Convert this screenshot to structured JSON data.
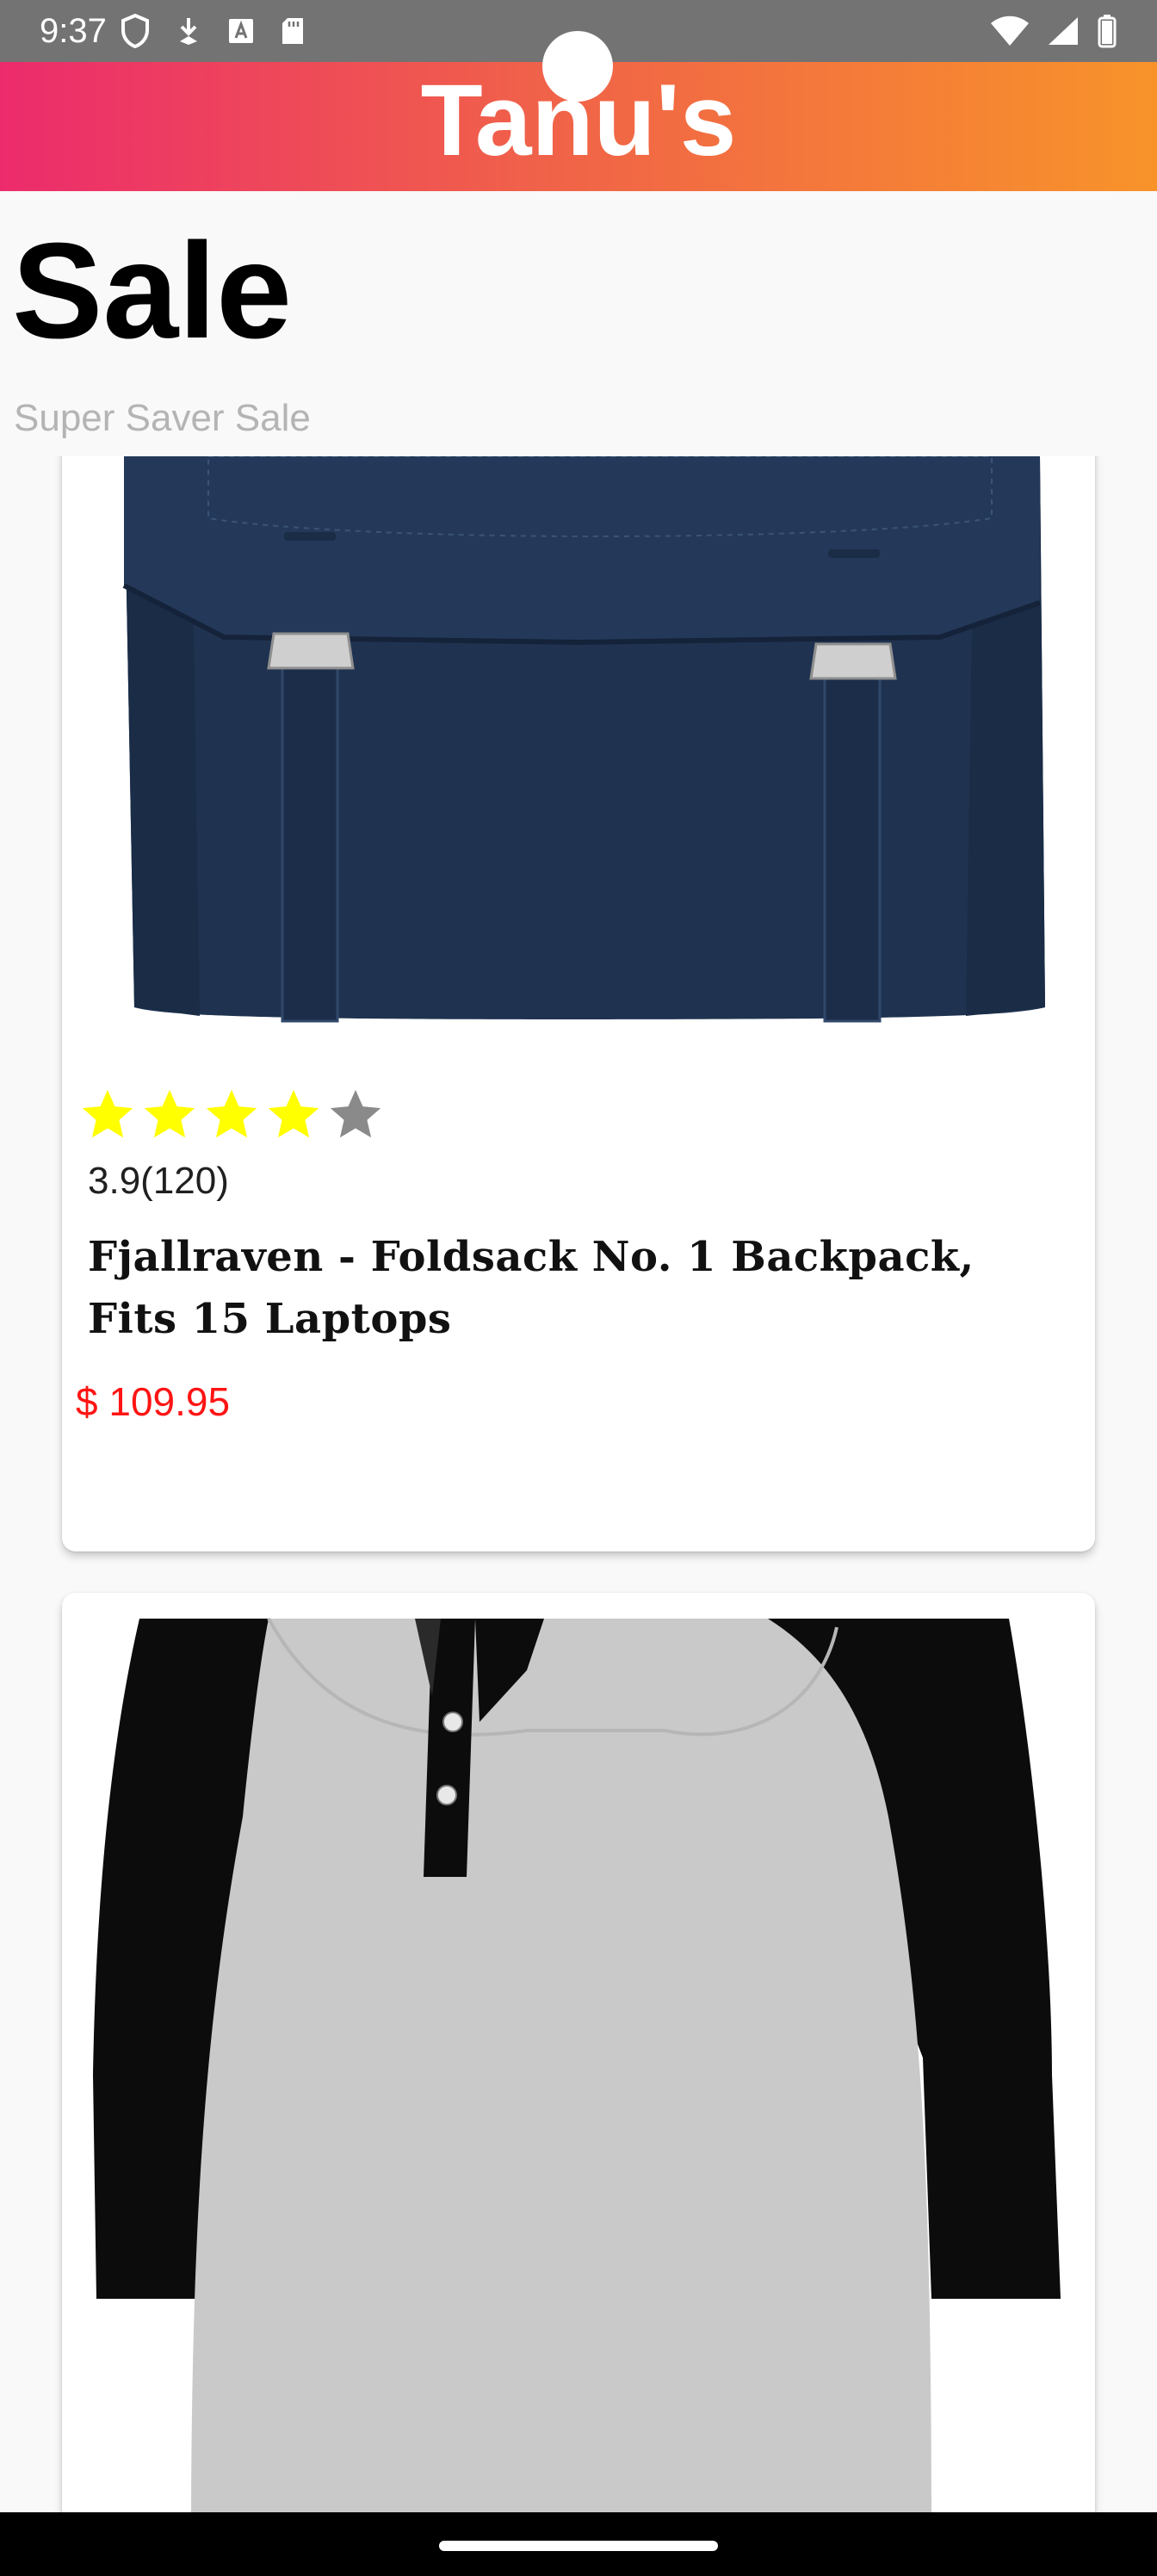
{
  "status_bar": {
    "time": "9:37",
    "left_icons": [
      "shield-icon",
      "download-icon",
      "font-icon",
      "sd-card-icon"
    ],
    "right_icons": [
      "wifi-icon",
      "signal-icon",
      "battery-icon"
    ]
  },
  "app_bar": {
    "title": "Tanu's",
    "gradient": [
      "#ec2b6c",
      "#f8932a"
    ]
  },
  "header": {
    "title": "Sale",
    "subtitle": "Super Saver Sale"
  },
  "products": [
    {
      "image": "backpack-image",
      "rating_stars": 4,
      "max_stars": 5,
      "rating_text": "3.9(120)",
      "name": "Fjallraven - Foldsack No. 1 Backpack, Fits 15 Laptops",
      "price": "$ 109.95"
    },
    {
      "image": "raglan-shirt-image"
    }
  ],
  "colors": {
    "star_filled": "#ffff00",
    "star_empty": "#8a8a8a",
    "price": "#ff1414"
  }
}
